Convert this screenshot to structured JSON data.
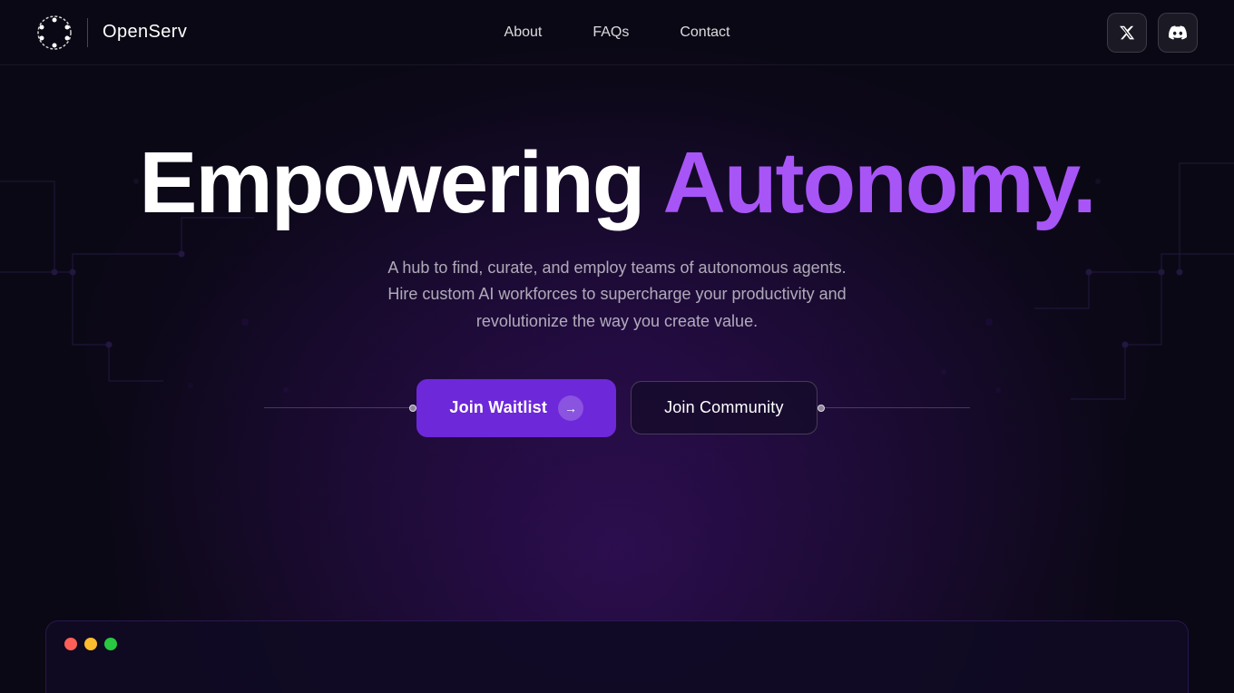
{
  "brand": {
    "name": "OpenServ",
    "logo_alt": "OpenServ logo"
  },
  "nav": {
    "links": [
      {
        "label": "About",
        "href": "#about"
      },
      {
        "label": "FAQs",
        "href": "#faqs"
      },
      {
        "label": "Contact",
        "href": "#contact"
      }
    ],
    "social": [
      {
        "name": "twitter",
        "symbol": "𝕏"
      },
      {
        "name": "discord",
        "symbol": "⊞"
      }
    ]
  },
  "hero": {
    "title_white": "Empowering",
    "title_purple": "Autonomy.",
    "subtitle": "A hub to find, curate, and employ teams of autonomous agents. Hire custom AI workforces to supercharge your productivity and revolutionize the way you create value.",
    "btn_waitlist": "Join Waitlist",
    "btn_community": "Join Community"
  },
  "colors": {
    "purple_accent": "#a855f7",
    "button_purple": "#6d28d9",
    "bg_dark": "#0a0814"
  },
  "window": {
    "dot_colors": [
      "#ff5f57",
      "#febc2e",
      "#28c840"
    ]
  }
}
